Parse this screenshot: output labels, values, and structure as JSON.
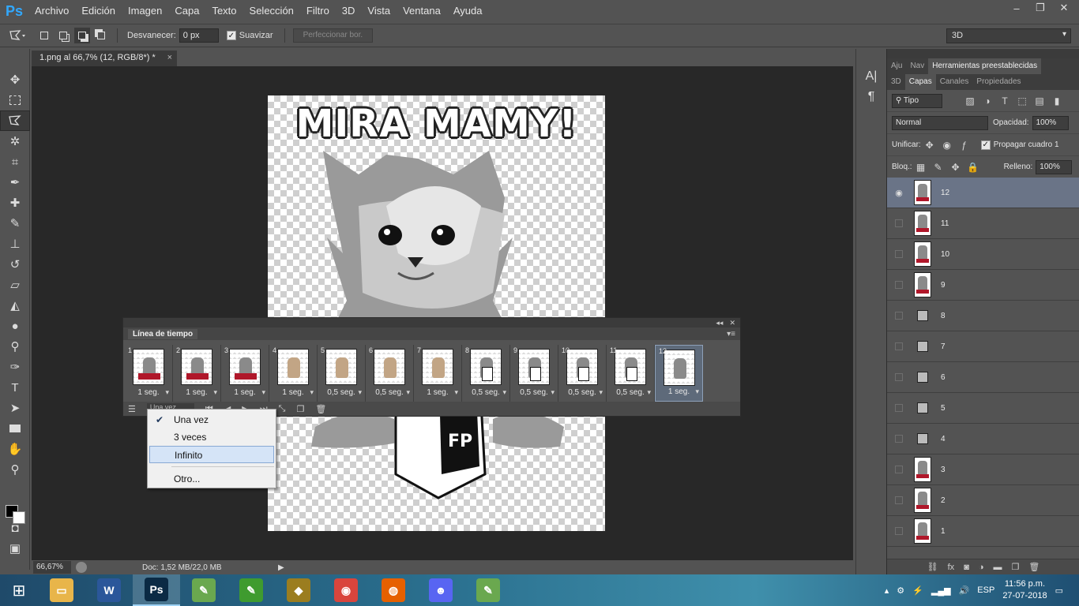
{
  "app": {
    "logo": "Ps"
  },
  "menu": [
    "Archivo",
    "Edición",
    "Imagen",
    "Capa",
    "Texto",
    "Selección",
    "Filtro",
    "3D",
    "Vista",
    "Ventana",
    "Ayuda"
  ],
  "window_buttons": [
    "–",
    "❐",
    "✕"
  ],
  "options": {
    "feather_label": "Desvanecer:",
    "feather_value": "0 px",
    "smooth_label": "Suavizar",
    "refine_button": "Perfeccionar bor.",
    "workspace": "3D"
  },
  "document": {
    "tab_title": "1.png al 66,7% (12, RGB/8*) *",
    "tab_close": "×",
    "canvas_title": "MIRA MAMY!"
  },
  "status": {
    "zoom": "66,67%",
    "doc_size": "Doc: 1,52 MB/22,0 MB"
  },
  "timeline": {
    "tab_label": "Línea de tiempo",
    "loop_value": "Una vez",
    "frames": [
      {
        "num": "1",
        "delay": "1 seg.",
        "thumb": "gray-red"
      },
      {
        "num": "2",
        "delay": "1 seg.",
        "thumb": "gray-red"
      },
      {
        "num": "3",
        "delay": "1 seg.",
        "thumb": "gray-red"
      },
      {
        "num": "4",
        "delay": "1 seg.",
        "thumb": "tan"
      },
      {
        "num": "5",
        "delay": "0,5 seg.",
        "thumb": "tan"
      },
      {
        "num": "6",
        "delay": "0,5 seg.",
        "thumb": "tan"
      },
      {
        "num": "7",
        "delay": "1 seg.",
        "thumb": "tan"
      },
      {
        "num": "8",
        "delay": "0,5 seg.",
        "thumb": "box"
      },
      {
        "num": "9",
        "delay": "0,5 seg.",
        "thumb": "box"
      },
      {
        "num": "10",
        "delay": "0,5 seg.",
        "thumb": "box"
      },
      {
        "num": "11",
        "delay": "0,5 seg.",
        "thumb": "box"
      },
      {
        "num": "12",
        "delay": "1 seg.",
        "thumb": "gray"
      }
    ]
  },
  "loop_menu": {
    "options": [
      "Una vez",
      "3 veces",
      "Infinito"
    ],
    "other": "Otro...",
    "checked": "Una vez",
    "highlighted": "Infinito"
  },
  "panels": {
    "top_tabs": [
      "Aju",
      "Nav",
      "Herramientas preestablecidas"
    ],
    "tabs": [
      "3D",
      "Capas",
      "Canales",
      "Propiedades"
    ],
    "active_tab": "Capas",
    "filter": "Tipo",
    "blend_mode": "Normal",
    "opacity_label": "Opacidad:",
    "opacity": "100%",
    "unify_label": "Unificar:",
    "propagate_label": "Propagar cuadro 1",
    "lock_label": "Bloq.:",
    "fill_label": "Relleno:",
    "fill": "100%",
    "layers": [
      {
        "name": "12",
        "visible": true,
        "thumb": "image"
      },
      {
        "name": "11",
        "visible": false,
        "thumb": "image"
      },
      {
        "name": "10",
        "visible": false,
        "thumb": "image"
      },
      {
        "name": "9",
        "visible": false,
        "thumb": "image"
      },
      {
        "name": "8",
        "visible": false,
        "thumb": "small"
      },
      {
        "name": "7",
        "visible": false,
        "thumb": "small"
      },
      {
        "name": "6",
        "visible": false,
        "thumb": "small"
      },
      {
        "name": "5",
        "visible": false,
        "thumb": "small"
      },
      {
        "name": "4",
        "visible": false,
        "thumb": "small"
      },
      {
        "name": "3",
        "visible": false,
        "thumb": "image"
      },
      {
        "name": "2",
        "visible": false,
        "thumb": "image"
      },
      {
        "name": "1",
        "visible": false,
        "thumb": "image"
      }
    ]
  },
  "taskbar": {
    "apps": [
      {
        "name": "file-explorer",
        "glyph": "▭",
        "color": "#e8b54a"
      },
      {
        "name": "word",
        "glyph": "W",
        "color": "#2b579a"
      },
      {
        "name": "photoshop",
        "glyph": "Ps",
        "color": "#0b2a44"
      },
      {
        "name": "app-green-1",
        "glyph": "✎",
        "color": "#6aa84f"
      },
      {
        "name": "app-green-2",
        "glyph": "✎",
        "color": "#3f9b2f"
      },
      {
        "name": "app-game",
        "glyph": "◆",
        "color": "#9b7d1f"
      },
      {
        "name": "chrome",
        "glyph": "◉",
        "color": "#d9453d"
      },
      {
        "name": "firefox",
        "glyph": "◍",
        "color": "#e66000"
      },
      {
        "name": "discord",
        "glyph": "☻",
        "color": "#5865f2"
      },
      {
        "name": "app-green-3",
        "glyph": "✎",
        "color": "#6aa84f"
      }
    ],
    "language": "ESP",
    "time": "11:56 p.m.",
    "date": "27-07-2018"
  }
}
